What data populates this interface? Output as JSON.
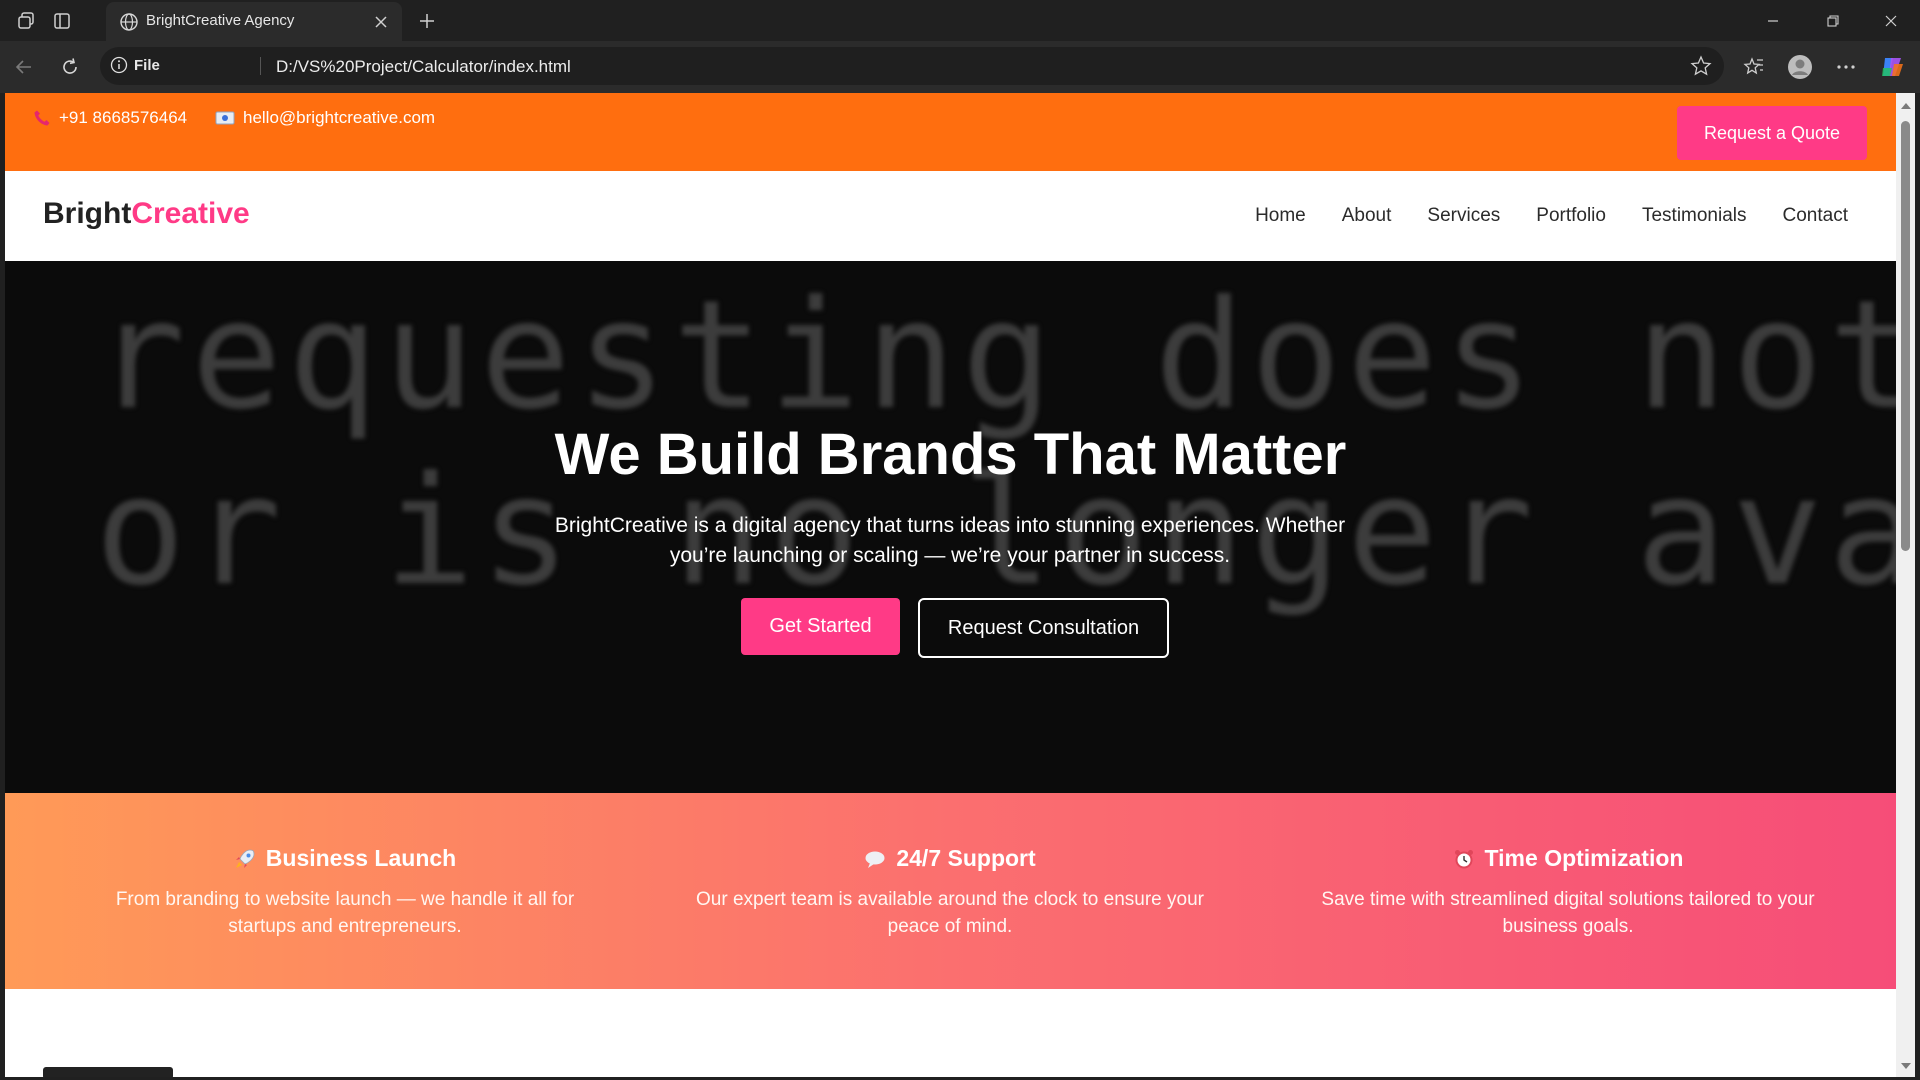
{
  "browser": {
    "tab_title": "BrightCreative Agency",
    "address_label": "File",
    "url": "D:/VS%20Project/Calculator/index.html",
    "icons": [
      "workspaces-icon",
      "vertical-tabs-icon",
      "globe-icon",
      "close-icon",
      "new-tab-icon",
      "minimize-icon",
      "restore-icon",
      "close-window-icon",
      "back-icon",
      "reload-icon",
      "info-icon",
      "star-icon",
      "favorites-icon",
      "profile-icon",
      "more-icon",
      "copilot-icon"
    ]
  },
  "topbar": {
    "phone": "+91 8668576464",
    "email": "hello@brightcreative.com",
    "quote_button": "Request a Quote",
    "color": "#ff6e0f"
  },
  "nav": {
    "logo_part1": "Bright",
    "logo_part2": "Creative",
    "links": [
      "Home",
      "About",
      "Services",
      "Portfolio",
      "Testimonials",
      "Contact"
    ]
  },
  "hero": {
    "background_text_line1": "requesting does not exist",
    "background_text_line2": "or is no longer available.",
    "title": "We Build Brands That Matter",
    "subtitle": "BrightCreative is a digital agency that turns ideas into stunning experiences. Whether you’re launching or scaling — we’re your partner in success.",
    "primary_button": "Get Started",
    "secondary_button": "Request Consultation"
  },
  "features": [
    {
      "icon": "rocket-icon",
      "title": "Business Launch",
      "desc": "From branding to website launch — we handle it all for startups and entrepreneurs."
    },
    {
      "icon": "speech-bubble-icon",
      "title": "24/7 Support",
      "desc": "Our expert team is available around the clock to ensure your peace of mind."
    },
    {
      "icon": "alarm-clock-icon",
      "title": "Time Optimization",
      "desc": "Save time with streamlined digital solutions tailored to your business goals."
    }
  ],
  "colors": {
    "accent": "#ff3a86",
    "dark": "#0b0b0b"
  }
}
